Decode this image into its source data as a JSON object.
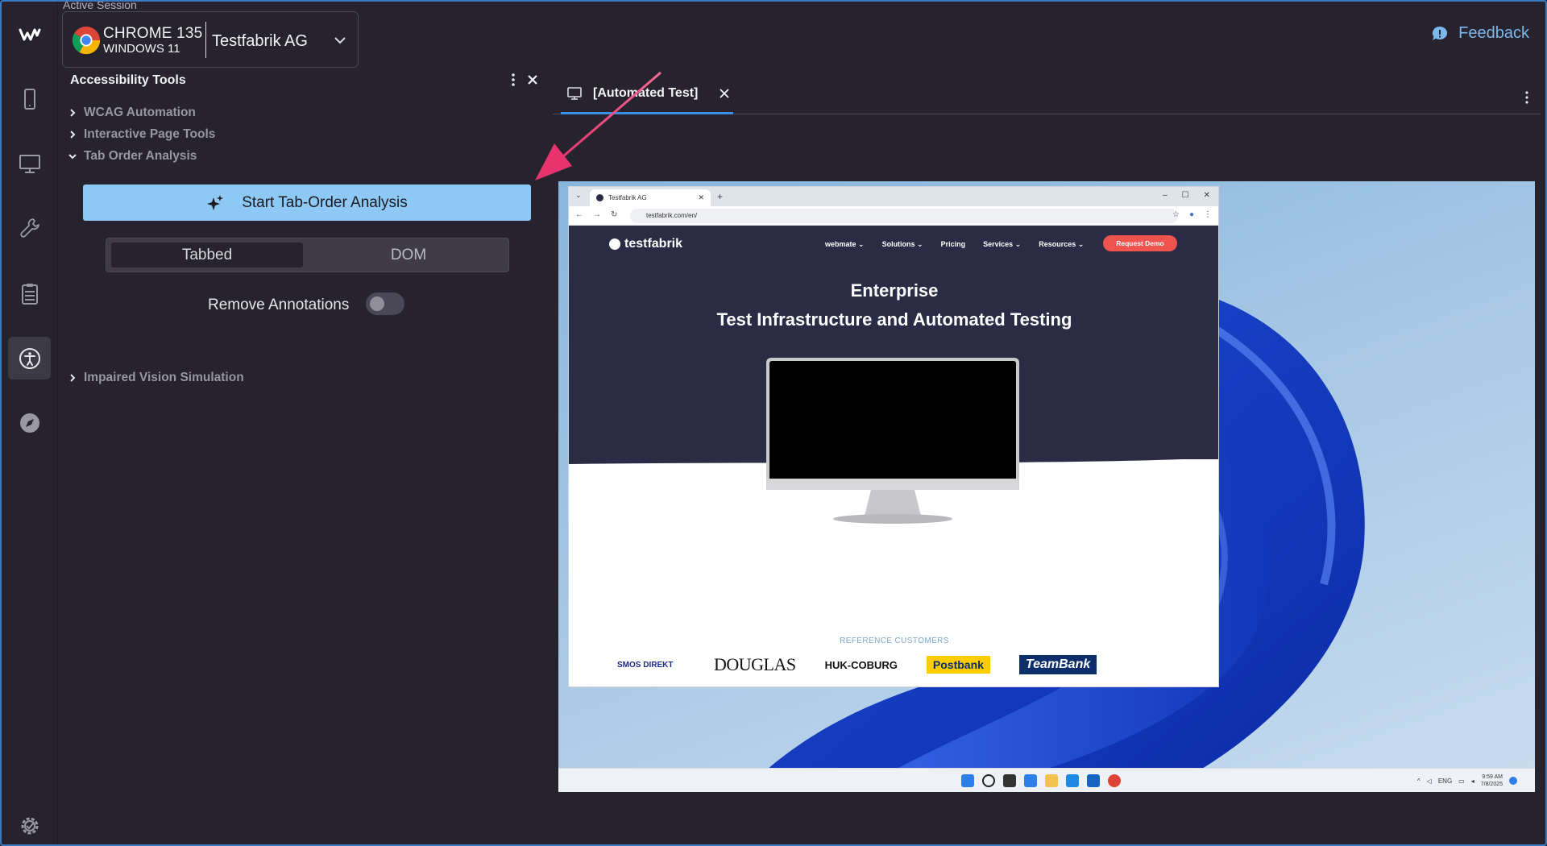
{
  "session": {
    "caption": "Active Session",
    "browser": "CHROME 135",
    "os": "WINDOWS 11",
    "organization": "Testfabrik AG"
  },
  "header": {
    "feedback_label": "Feedback"
  },
  "panel": {
    "title": "Accessibility Tools",
    "items": [
      {
        "label": "WCAG Automation",
        "expanded": false
      },
      {
        "label": "Interactive Page Tools",
        "expanded": false
      },
      {
        "label": "Tab Order Analysis",
        "expanded": true
      },
      {
        "label": "Impaired Vision Simulation",
        "expanded": false
      }
    ],
    "start_button": "Start Tab-Order Analysis",
    "segments": [
      "Tabbed",
      "DOM"
    ],
    "selected_segment": "Tabbed",
    "remove_annotations_label": "Remove Annotations",
    "remove_annotations_on": false
  },
  "workspace": {
    "tab_label": "[Automated Test]"
  },
  "remote": {
    "browser_tab": "Testfabrik AG",
    "url": "testfabrik.com/en/",
    "site": {
      "logo": "testfabrik",
      "nav": [
        "webmate ⌄",
        "Solutions ⌄",
        "Pricing",
        "Services ⌄",
        "Resources ⌄"
      ],
      "cta": "Request Demo",
      "headline1": "Enterprise",
      "headline2": "Test Infrastructure and Automated Testing",
      "ref_title": "REFERENCE CUSTOMERS",
      "logos": [
        "SMOS DIREKT",
        "DOUGLAS",
        "HUK-COBURG",
        "Postbank",
        "TeamBank"
      ]
    },
    "taskbar": {
      "lang": "ENG",
      "time": "9:59 AM",
      "date": "7/8/2025"
    }
  },
  "colors": {
    "accent": "#8ec8f4",
    "link": "#7fb8ea",
    "tab_underline": "#3a8fe0",
    "arrow": "#e8336e"
  }
}
